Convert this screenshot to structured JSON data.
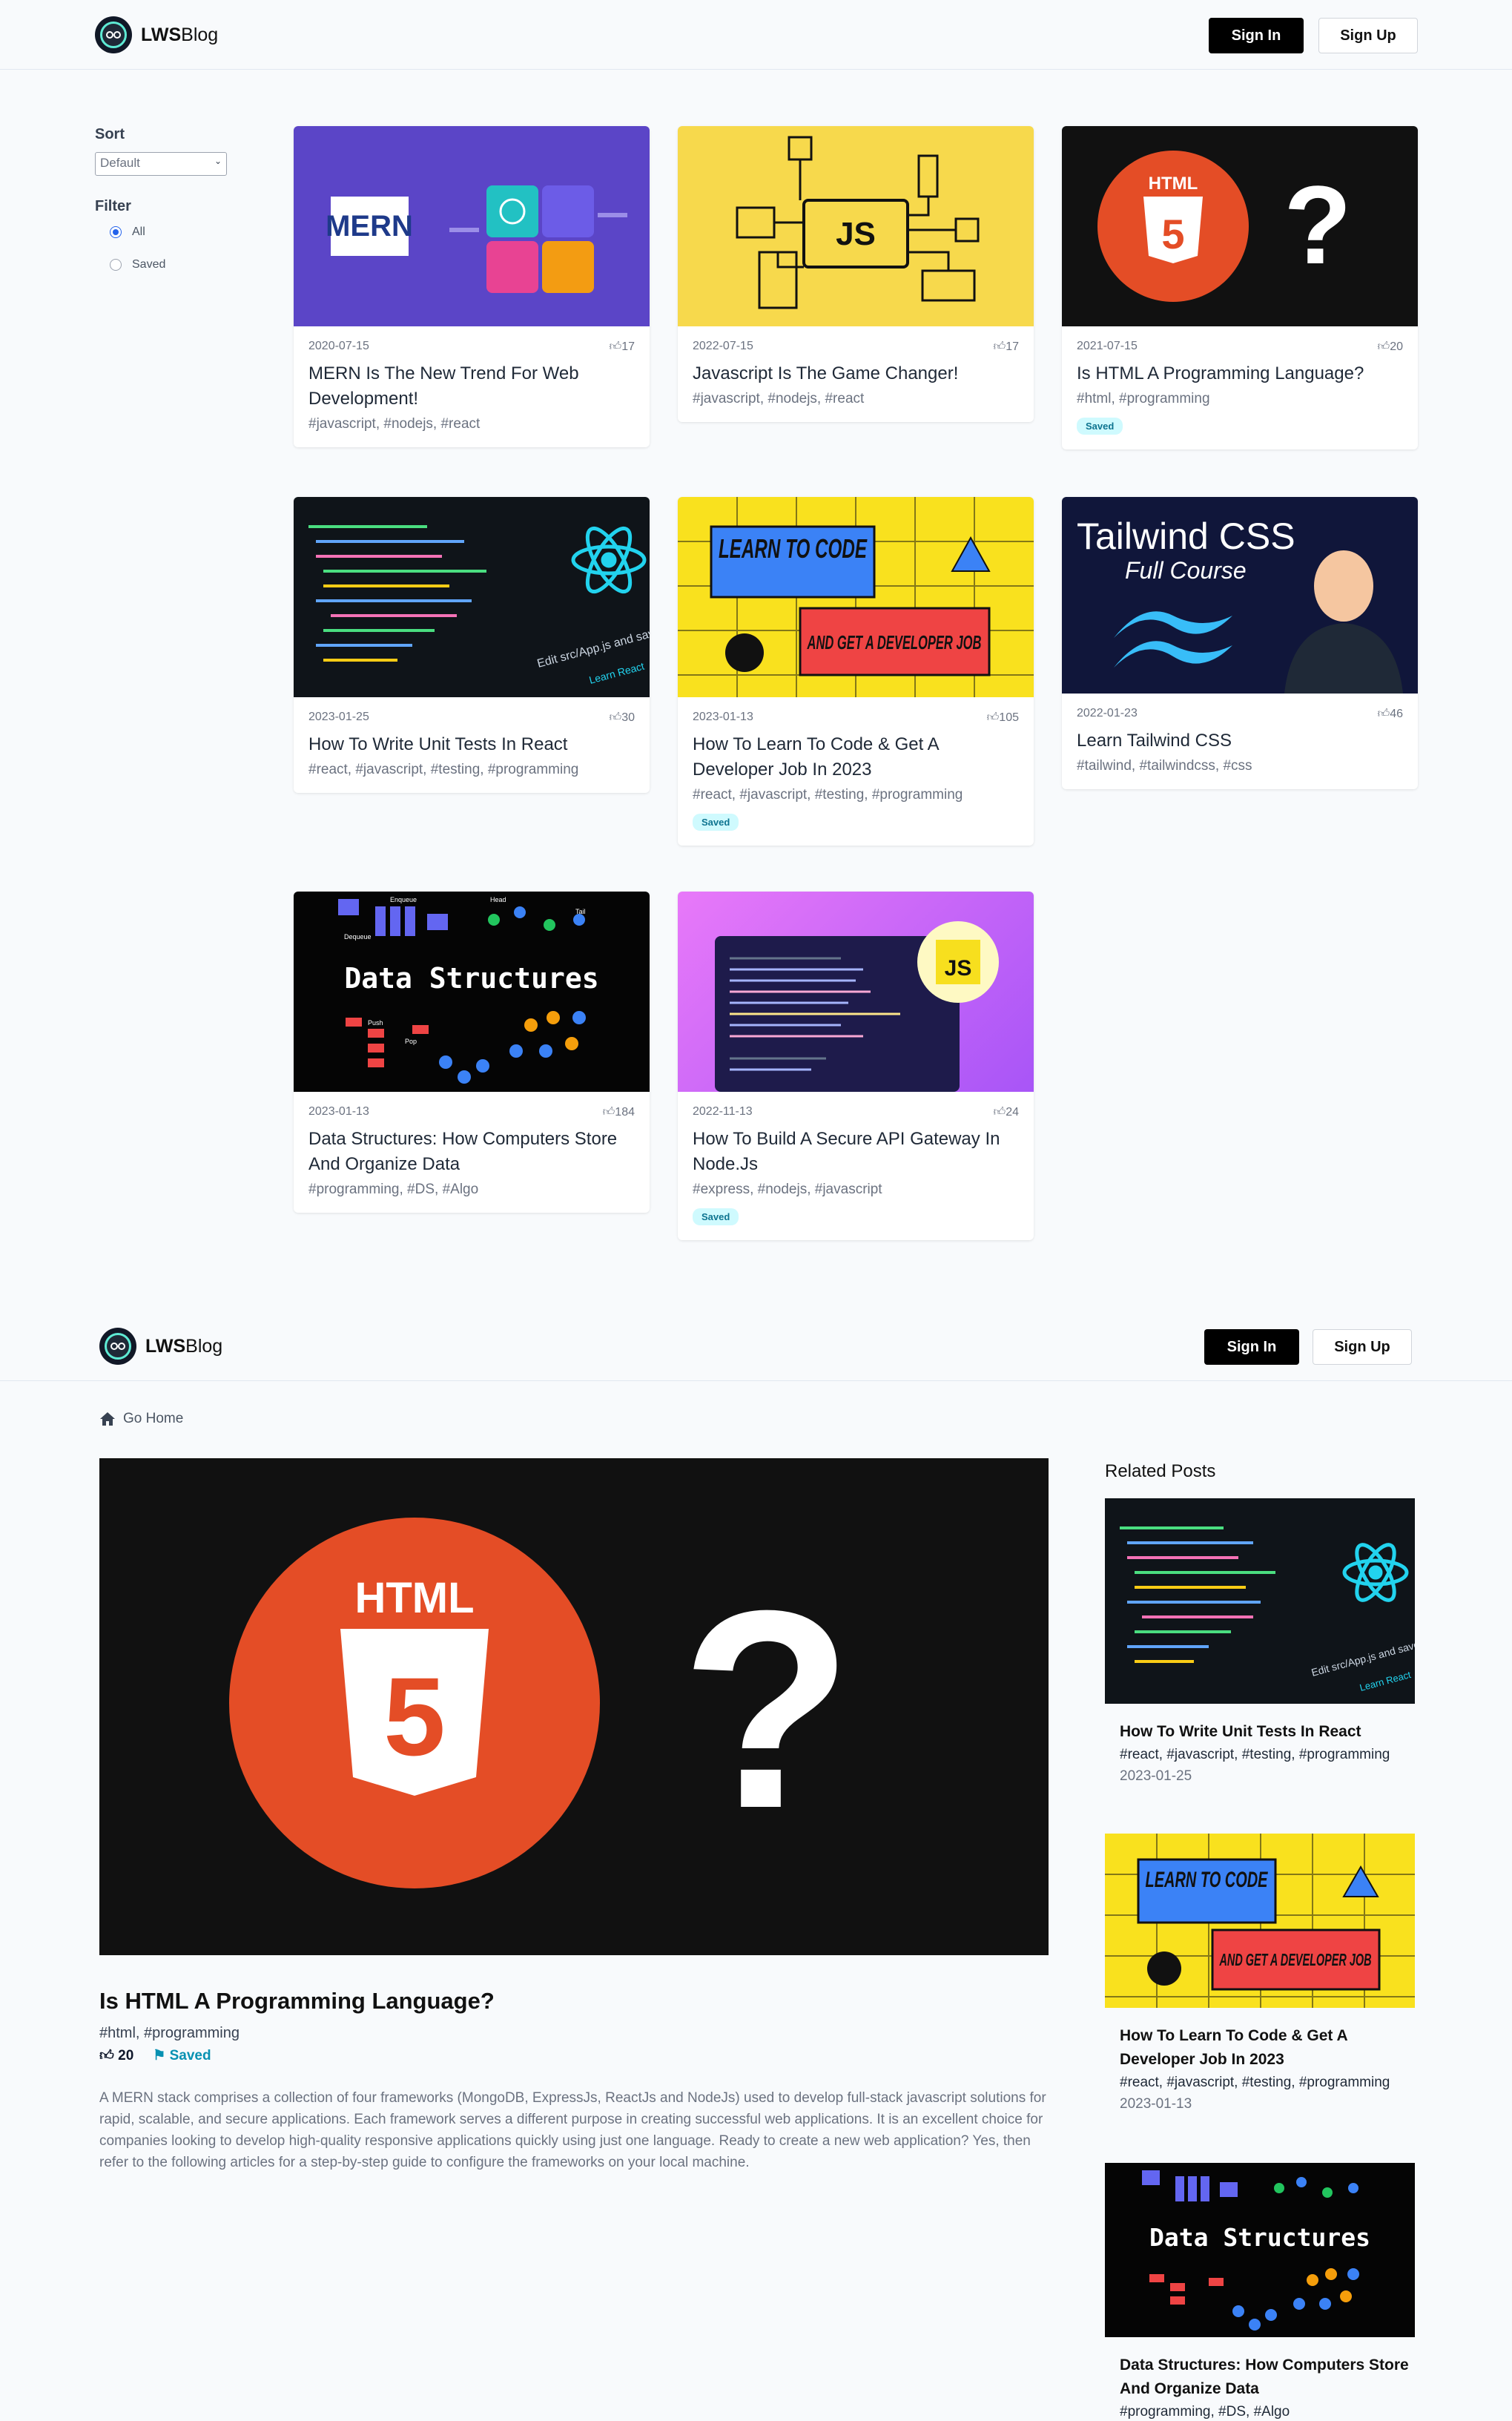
{
  "brand": {
    "strong": "LWS",
    "rest": "Blog"
  },
  "auth": {
    "sign_in": "Sign In",
    "sign_up": "Sign Up"
  },
  "sidebar": {
    "sort_label": "Sort",
    "sort_value": "Default",
    "filter_label": "Filter",
    "filter_options": [
      "All",
      "Saved"
    ],
    "selected_filter": "All"
  },
  "posts": [
    {
      "date": "2020-07-15",
      "likes": "17",
      "title": "MERN Is The New Trend For Web Development!",
      "tags": "#javascript, #nodejs, #react",
      "saved": "",
      "thumb": "MERN"
    },
    {
      "date": "2022-07-15",
      "likes": "17",
      "title": "Javascript Is The Game Changer!",
      "tags": "#javascript, #nodejs, #react",
      "saved": "",
      "thumb": "JS"
    },
    {
      "date": "2021-07-15",
      "likes": "20",
      "title": "Is HTML A Programming Language?",
      "tags": "#html, #programming",
      "saved": "Saved",
      "thumb": "HTML"
    },
    {
      "date": "2023-01-25",
      "likes": "30",
      "title": "How To Write Unit Tests In React",
      "tags": "#react, #javascript, #testing, #programming",
      "saved": "",
      "thumb": "Edit src/App.js and save to reload.",
      "thumb_link": "Learn React"
    },
    {
      "date": "2023-01-13",
      "likes": "105",
      "title": "How To Learn To Code & Get A Developer Job In 2023",
      "tags": "#react, #javascript, #testing, #programming",
      "saved": "Saved",
      "thumb": "LEARN TO CODE",
      "thumb2": "AND GET A DEVELOPER JOB"
    },
    {
      "date": "2022-01-23",
      "likes": "46",
      "title": "Learn Tailwind CSS",
      "tags": "#tailwind, #tailwindcss, #css",
      "saved": "",
      "thumb": "Tailwind CSS",
      "thumb2": "Full Course"
    },
    {
      "date": "2023-01-13",
      "likes": "184",
      "title": "Data Structures: How Computers Store And Organize Data",
      "tags": "#programming, #DS, #Algo",
      "saved": "",
      "thumb": "Data Structures",
      "thumb_enqueue": "Enqueue",
      "thumb_dequeue": "Dequeue",
      "thumb_head": "Head",
      "thumb_tail": "Tail",
      "thumb_push": "Push",
      "thumb_pop": "Pop"
    },
    {
      "date": "2022-11-13",
      "likes": "24",
      "title": "How To Build A Secure API Gateway In Node.Js",
      "tags": "#express, #nodejs, #javascript",
      "saved": "Saved",
      "thumb": "JS"
    }
  ],
  "detail": {
    "go_home": "Go Home",
    "hero_badge": "HTML",
    "hero_mark": "?",
    "title": "Is HTML A Programming Language?",
    "tags": "#html, #programming",
    "likes": "20",
    "saved": "Saved",
    "description": "A MERN stack comprises a collection of four frameworks (MongoDB, ExpressJs, ReactJs and NodeJs) used to develop full-stack javascript solutions for rapid, scalable, and secure applications. Each framework serves a different purpose in creating successful web applications. It is an excellent choice for companies looking to develop high-quality responsive applications quickly using just one language. Ready to create a new web application? Yes, then refer to the following articles for a step-by-step guide to configure the frameworks on your local machine.",
    "related_heading": "Related Posts",
    "related": [
      {
        "title": "How To Write Unit Tests In React",
        "tags": "#react, #javascript, #testing, #programming",
        "date": "2023-01-25"
      },
      {
        "title": "How To Learn To Code & Get A Developer Job In 2023",
        "tags": "#react, #javascript, #testing, #programming",
        "date": "2023-01-13"
      },
      {
        "title": "Data Structures: How Computers Store And Organize Data",
        "tags": "#programming, #DS, #Algo",
        "date": ""
      }
    ]
  },
  "colors": {
    "accent": "#0891b2",
    "saved_bg": "#cffafe",
    "html_orange": "#e44d26",
    "js_yellow": "#f7df1e",
    "mern_purple": "#5b45c7"
  }
}
